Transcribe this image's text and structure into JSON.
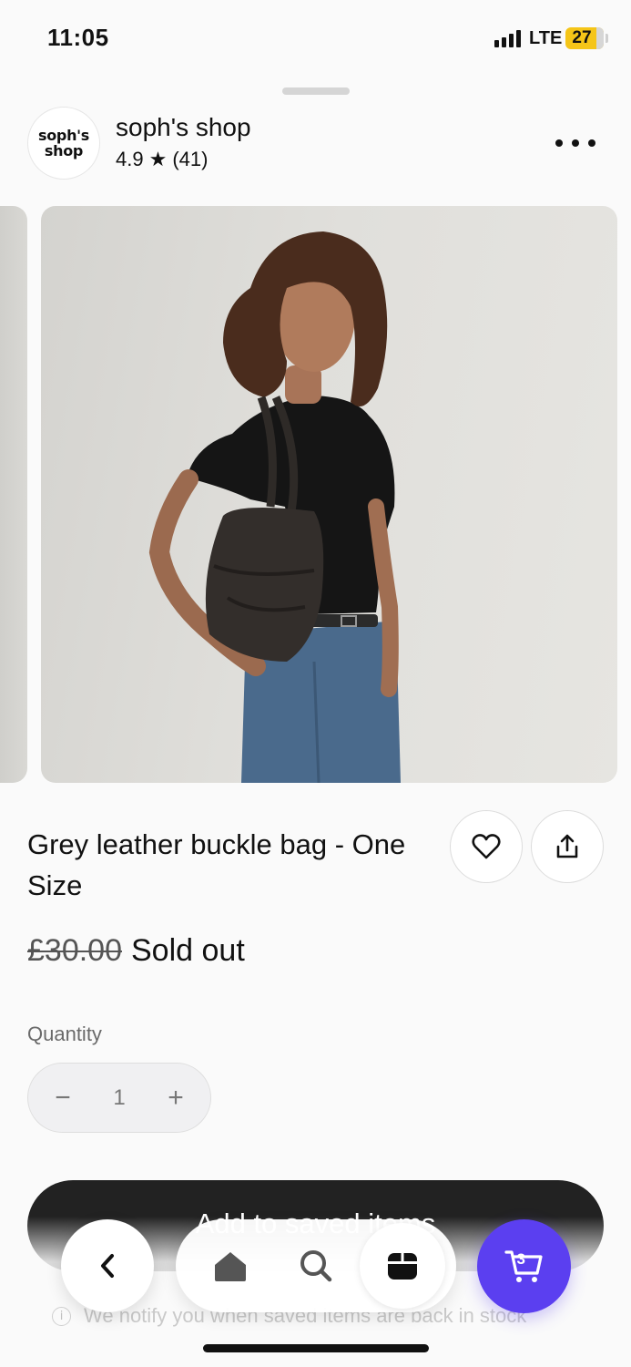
{
  "status_bar": {
    "time": "11:05",
    "network": "LTE",
    "battery": "27"
  },
  "shop": {
    "logo_text_line1": "soph's",
    "logo_text_line2": "shop",
    "name": "soph's shop",
    "rating": "4.9",
    "rating_star": "★",
    "review_count": "(41)"
  },
  "product": {
    "title": "Grey leather buckle bag - One Size",
    "original_price": "£30.00",
    "status": "Sold out"
  },
  "quantity": {
    "label": "Quantity",
    "value": "1",
    "minus": "−",
    "plus": "+"
  },
  "cta": {
    "label": "Add to saved items",
    "notice": "We notify you when saved items are back in stock"
  },
  "nav": {
    "cart_count": "3"
  },
  "colors": {
    "accent": "#5b3ff0",
    "battery": "#f5c518",
    "cta_bg": "#222222"
  },
  "icons": [
    "more-icon",
    "heart-icon",
    "share-icon",
    "info-icon",
    "chevron-left-icon",
    "home-icon",
    "search-icon",
    "orders-icon",
    "cart-icon"
  ]
}
